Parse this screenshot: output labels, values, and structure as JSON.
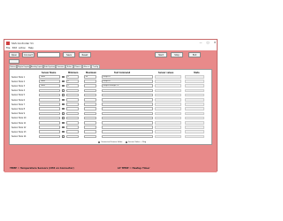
{
  "window": {
    "title": "SGS Controller V1",
    "min": "—",
    "max": "□",
    "close": "✕"
  },
  "menu": [
    "File",
    "Edit",
    "Action",
    "Help"
  ],
  "toolbar": {
    "left": [
      {
        "label": "Open"
      },
      {
        "label": "Connect"
      }
    ],
    "combo_value": "",
    "mid": [
      {
        "label": "Save"
      },
      {
        "label": "Reset"
      }
    ],
    "right": [
      {
        "label": "Start"
      },
      {
        "label": "Stop"
      },
      {
        "label": "Exit"
      }
    ]
  },
  "tabs": [
    "Status",
    "Digital Inputs",
    "Analog Inputs",
    "Sub-Systems",
    "Sensors",
    "Rules",
    "Phases",
    "Alarms",
    "Config"
  ],
  "table": {
    "headers": {
      "sensor_name": "Sensor Name",
      "minimum": "Minimum",
      "maximum": "Maximum",
      "text_command": "Text Command",
      "sensor_values": "Sensor values",
      "state": "State"
    },
    "rows": [
      {
        "label": "Sensor Rule 1",
        "name": "TEMP",
        "min": "0",
        "max": "50",
        "cmd": "temp>0"
      },
      {
        "label": "Sensor Rule 2",
        "name": "TEMP",
        "min": "0",
        "max": "",
        "cmd": "temp<0"
      },
      {
        "label": "Sensor Rule 3",
        "name": "TEMP",
        "min": "0",
        "max": "",
        "cmd": "temp1+temp2>0"
      },
      {
        "label": "Sensor Rule 4",
        "name": "",
        "min": "",
        "max": "",
        "cmd": ""
      },
      {
        "label": "Sensor Rule 5",
        "name": "",
        "min": "",
        "max": "",
        "cmd": ""
      },
      {
        "label": "Sensor Rule 6",
        "name": "",
        "min": "",
        "max": "",
        "cmd": ""
      },
      {
        "label": "Sensor Rule 7",
        "name": "",
        "min": "",
        "max": "",
        "cmd": ""
      },
      {
        "label": "Sensor Rule 8",
        "name": "",
        "min": "",
        "max": "",
        "cmd": ""
      },
      {
        "label": "Sensor Rule 9",
        "name": "",
        "min": "",
        "max": "",
        "cmd": ""
      },
      {
        "label": "Sensor Rule 10",
        "name": "",
        "min": "",
        "max": "",
        "cmd": ""
      },
      {
        "label": "Sensor Rule 11",
        "name": "",
        "min": "",
        "max": "",
        "cmd": ""
      },
      {
        "label": "Sensor Rule 12",
        "name": "",
        "min": "",
        "max": "",
        "cmd": ""
      },
      {
        "label": "Sensor Rule 13",
        "name": "",
        "min": "",
        "max": "",
        "cmd": ""
      },
      {
        "label": "Sensor Rule 14",
        "name": "",
        "min": "",
        "max": "",
        "cmd": ""
      }
    ],
    "footer_left": "Connected Sensor Value",
    "footer_right": "Sensor Value > Flag"
  },
  "legend": {
    "left": "TEMP = Temperature Sensors (CH8 on Connector)",
    "right": "LP TEMP = Heatup Timer"
  }
}
